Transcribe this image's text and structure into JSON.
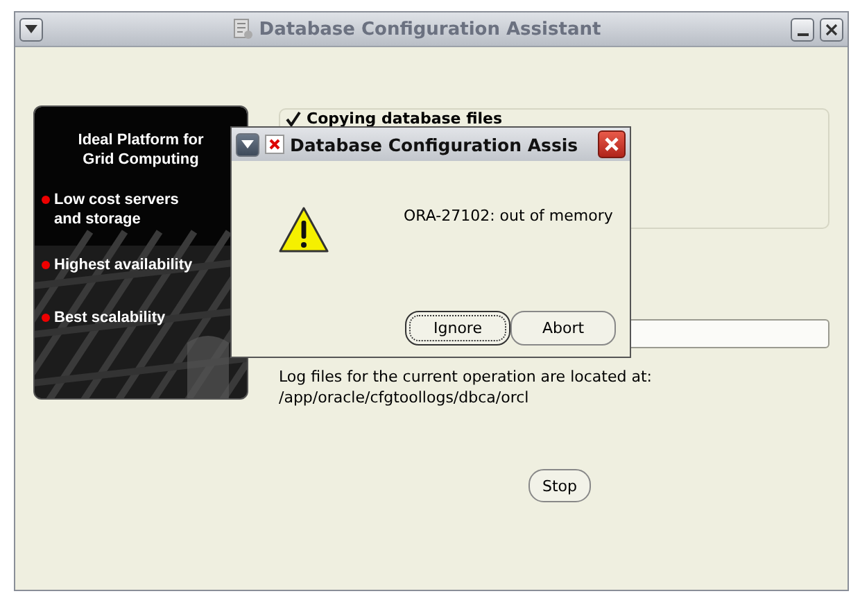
{
  "window": {
    "title": "Database Configuration Assistant"
  },
  "banner": {
    "heading": [
      "Ideal Platform for",
      "Grid Computing"
    ],
    "bullets": [
      "Low cost servers and storage",
      "Highest availability",
      "Best scalability"
    ]
  },
  "steps": [
    {
      "label": "Copying database files",
      "checked": true
    }
  ],
  "progress": {
    "level": 0
  },
  "log_note": [
    "Log files for the current operation are located at:",
    "/app/oracle/cfgtoollogs/dbca/orcl"
  ],
  "buttons": [
    {
      "label": "Stop"
    }
  ],
  "dialog": {
    "title": "Database Configuration Assis",
    "message": "ORA-27102: out of memory",
    "buttons": [
      {
        "label": "Ignore",
        "focused": true
      },
      {
        "label": "Abort",
        "focused": false
      }
    ]
  }
}
